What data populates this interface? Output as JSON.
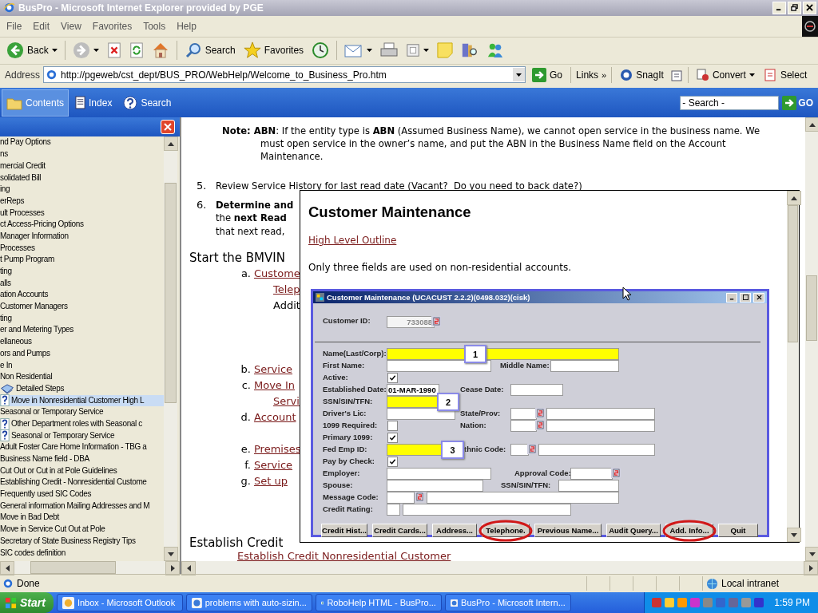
{
  "window": {
    "title": "BusPro - Microsoft Internet Explorer provided by PGE"
  },
  "menu": [
    "File",
    "Edit",
    "View",
    "Favorites",
    "Tools",
    "Help"
  ],
  "toolbar": [
    {
      "kind": "back",
      "label": "Back"
    },
    {
      "kind": "forward"
    },
    {
      "kind": "stop"
    },
    {
      "kind": "refresh"
    },
    {
      "kind": "home"
    },
    {
      "kind": "search",
      "label": "Search"
    },
    {
      "kind": "favorites",
      "label": "Favorites"
    },
    {
      "kind": "history"
    },
    {
      "kind": "mail"
    },
    {
      "kind": "print"
    },
    {
      "kind": "edit"
    },
    {
      "kind": "note"
    },
    {
      "kind": "research"
    },
    {
      "kind": "messenger"
    }
  ],
  "address": {
    "label": "Address",
    "value": "http://pgeweb/cst_dept/BUS_PRO/WebHelp/Welcome_to_Business_Pro.htm",
    "go": "Go"
  },
  "links": {
    "label": "Links",
    "more": "»",
    "snagit": "SnagIt",
    "convert": "Convert",
    "select": "Select"
  },
  "help_nav": {
    "tabs": [
      {
        "label": "Contents",
        "selected": true
      },
      {
        "label": "Index",
        "selected": false
      },
      {
        "label": "Search",
        "selected": false
      }
    ],
    "placeholder": "- Search -",
    "go": "GO"
  },
  "toc": [
    {
      "kind": "text",
      "text": "nd Pay Options",
      "selected": false
    },
    {
      "kind": "text",
      "text": "ns",
      "selected": false
    },
    {
      "kind": "text",
      "text": "mercial Credit",
      "selected": false
    },
    {
      "kind": "text",
      "text": "solidated Bill",
      "selected": false
    },
    {
      "kind": "text",
      "text": "ing",
      "selected": false
    },
    {
      "kind": "text",
      "text": "erReps",
      "selected": false
    },
    {
      "kind": "text",
      "text": "ult Processes",
      "selected": false
    },
    {
      "kind": "text",
      "text": "ct Access-Pricing Options",
      "selected": false
    },
    {
      "kind": "text",
      "text": "Manager Information",
      "selected": false
    },
    {
      "kind": "text",
      "text": "Processes",
      "selected": false
    },
    {
      "kind": "text",
      "text": "t Pump Program",
      "selected": false
    },
    {
      "kind": "text",
      "text": "ting",
      "selected": false
    },
    {
      "kind": "text",
      "text": "alls",
      "selected": false
    },
    {
      "kind": "text",
      "text": "ation Accounts",
      "selected": false
    },
    {
      "kind": "text",
      "text": "Customer Managers",
      "selected": false
    },
    {
      "kind": "text",
      "text": "ting",
      "selected": false
    },
    {
      "kind": "text",
      "text": "er and Metering Types",
      "selected": false
    },
    {
      "kind": "text",
      "text": "ellaneous",
      "selected": false
    },
    {
      "kind": "text",
      "text": "ors and Pumps",
      "selected": false
    },
    {
      "kind": "text",
      "text": "e In",
      "selected": false
    },
    {
      "kind": "text",
      "text": "Non Residential",
      "selected": false
    },
    {
      "kind": "book",
      "text": "Detailed Steps",
      "selected": false
    },
    {
      "kind": "topic",
      "text": "Move in Nonresidential Customer High L",
      "selected": true
    },
    {
      "kind": "text",
      "text": "Seasonal or Temporary Service",
      "selected": false
    },
    {
      "kind": "topic",
      "text": "Other Department roles with Seasonal c",
      "selected": false
    },
    {
      "kind": "topic",
      "text": "Seasonal or Temporary Service",
      "selected": false
    },
    {
      "kind": "text",
      "text": "Adult Foster Care Home Information - TBG a",
      "selected": false
    },
    {
      "kind": "text",
      "text": "Business Name field - DBA",
      "selected": false
    },
    {
      "kind": "text",
      "text": "Cut Out or Cut in at Pole Guidelines",
      "selected": false
    },
    {
      "kind": "text",
      "text": "Establishing Credit - Nonresidential Custome",
      "selected": false
    },
    {
      "kind": "text",
      "text": "Frequently used SIC Codes",
      "selected": false
    },
    {
      "kind": "text",
      "text": "General information Mailing Addresses and M",
      "selected": false
    },
    {
      "kind": "text",
      "text": "Move in Bad Debt",
      "selected": false
    },
    {
      "kind": "text",
      "text": "Move in Service Cut Out at Pole",
      "selected": false
    },
    {
      "kind": "text",
      "text": "Secretary of State Business Registry Tips",
      "selected": false
    },
    {
      "kind": "text",
      "text": "SIC codes definition",
      "selected": false
    }
  ],
  "content": {
    "note": "**Note: ABN**: If the entity type is **ABN** (Assumed Business Name), we cannot open service in the business name. We must open service in the owner’s name, and put the ABN in the Business Name field on the Account Maintenance.",
    "steps": [
      {
        "number": "5.",
        "lines": [
          "Review Service History for last read date (Vacant?  Do you need to back date?)"
        ]
      },
      {
        "number": "6.",
        "lines": [
          "**Determine and**",
          "the **next Read**",
          "that next read,"
        ]
      }
    ],
    "heading": "Start the BMVIN",
    "substeps": [
      {
        "marker": "a.",
        "kind": "link",
        "text": "Custome",
        "children": [
          {
            "kind": "link",
            "text": "Telep"
          },
          {
            "kind": "text",
            "text": "Addit"
          }
        ]
      },
      {
        "marker": "b.",
        "kind": "link",
        "text": "Service"
      },
      {
        "marker": "c.",
        "kind": "link",
        "text": "Move In",
        "children": [
          {
            "kind": "link",
            "text": "Servi"
          }
        ]
      },
      {
        "marker": "d.",
        "kind": "link",
        "text": "Account"
      },
      {
        "marker": "e.",
        "kind": "link",
        "text": "Premises"
      },
      {
        "marker": "f.",
        "kind": "link",
        "text": "Service"
      },
      {
        "marker": "g.",
        "kind": "link",
        "text": "Set up"
      }
    ],
    "heading_2": "Establish Credit",
    "link": "Establish Credit Nonresidential Customer"
  },
  "popup": {
    "title": "Customer Maintenance",
    "link": "High Level Outline",
    "text": "Only three fields are used on non-residential accounts.",
    "form": {
      "title": "Customer Maintenance (UCACUST 2.2.2)(0498.032)(cisk)",
      "rows": [
        {
          "cells": [
            {
              "kind": "label",
              "text": "Customer ID:"
            },
            {
              "kind": "field",
              "value": "733088",
              "disabled": true
            },
            {
              "kind": "lookup"
            }
          ]
        },
        {
          "cells": [
            {
              "kind": "label",
              "text": "Name(Last/Corp):"
            },
            {
              "kind": "field",
              "highlighted": true
            },
            {
              "kind": "callout",
              "text": "1"
            }
          ]
        },
        {
          "cells": [
            {
              "kind": "label",
              "text": "First Name:"
            },
            {
              "kind": "field"
            },
            {
              "kind": "label",
              "text": "Middle Name:"
            },
            {
              "kind": "field"
            }
          ]
        },
        {
          "cells": [
            {
              "kind": "label",
              "text": "Active:"
            },
            {
              "kind": "check",
              "checked": true
            }
          ]
        },
        {
          "cells": [
            {
              "kind": "label",
              "text": "Established Date:"
            },
            {
              "kind": "field",
              "value": "01-MAR-1990"
            },
            {
              "kind": "label",
              "text": "Cease Date:"
            },
            {
              "kind": "field"
            }
          ]
        },
        {
          "cells": [
            {
              "kind": "label",
              "text": "SSN/SIN/TFN:"
            },
            {
              "kind": "field",
              "highlighted": true
            },
            {
              "kind": "callout",
              "text": "2"
            }
          ]
        },
        {
          "cells": [
            {
              "kind": "label",
              "text": "Driver's Lic:"
            },
            {
              "kind": "field"
            },
            {
              "kind": "label",
              "text": "State/Prov:"
            },
            {
              "kind": "field"
            },
            {
              "kind": "lookup"
            },
            {
              "kind": "field"
            }
          ]
        },
        {
          "cells": [
            {
              "kind": "label",
              "text": "1099 Required:"
            },
            {
              "kind": "check",
              "checked": false
            },
            {
              "kind": "label",
              "text": "Nation:"
            },
            {
              "kind": "field"
            },
            {
              "kind": "lookup"
            },
            {
              "kind": "field"
            }
          ]
        },
        {
          "cells": [
            {
              "kind": "label",
              "text": "Primary 1099:"
            },
            {
              "kind": "check",
              "checked": true
            }
          ]
        },
        {
          "cells": [
            {
              "kind": "label",
              "text": "Fed Emp ID:"
            },
            {
              "kind": "field",
              "highlighted": true
            },
            {
              "kind": "callout",
              "text": "3"
            },
            {
              "kind": "label",
              "text": "thnic Code:"
            },
            {
              "kind": "field"
            },
            {
              "kind": "lookup"
            },
            {
              "kind": "field"
            }
          ]
        },
        {
          "cells": [
            {
              "kind": "label",
              "text": "Pay by Check:"
            },
            {
              "kind": "check",
              "checked": true
            }
          ]
        },
        {
          "cells": [
            {
              "kind": "label",
              "text": "Employer:"
            },
            {
              "kind": "field"
            },
            {
              "kind": "label",
              "text": "Approval Code:"
            },
            {
              "kind": "field"
            },
            {
              "kind": "lookup"
            }
          ]
        },
        {
          "cells": [
            {
              "kind": "label",
              "text": "Spouse:"
            },
            {
              "kind": "field"
            },
            {
              "kind": "label",
              "text": "SSN/SIN/TFN:"
            },
            {
              "kind": "field"
            }
          ]
        },
        {
          "cells": [
            {
              "kind": "label",
              "text": "Message Code:"
            },
            {
              "kind": "field"
            },
            {
              "kind": "lookup"
            },
            {
              "kind": "field"
            }
          ]
        },
        {
          "cells": [
            {
              "kind": "label",
              "text": "Credit Rating:"
            },
            {
              "kind": "field"
            },
            {
              "kind": "field"
            }
          ]
        }
      ],
      "buttons": [
        {
          "label": "Credit Hist...",
          "circled": false
        },
        {
          "label": "Credit Cards...",
          "circled": false
        },
        {
          "label": "Address...",
          "circled": false
        },
        {
          "label": "Telephone.",
          "circled": true
        },
        {
          "label": "Previous Name...",
          "circled": false
        },
        {
          "label": "Audit Query...",
          "circled": false
        },
        {
          "label": "Add. Info...",
          "circled": true
        },
        {
          "label": "Quit",
          "circled": false
        }
      ]
    }
  },
  "status_bar": {
    "text": "Done",
    "zone": "Local intranet"
  },
  "taskbar": {
    "start": "Start",
    "items": [
      "Inbox - Microsoft Outlook",
      "problems with auto-sizin...",
      "RoboHelp HTML - BusPro...",
      "BusPro - Microsoft Intern..."
    ],
    "clock": "1:59 PM"
  }
}
